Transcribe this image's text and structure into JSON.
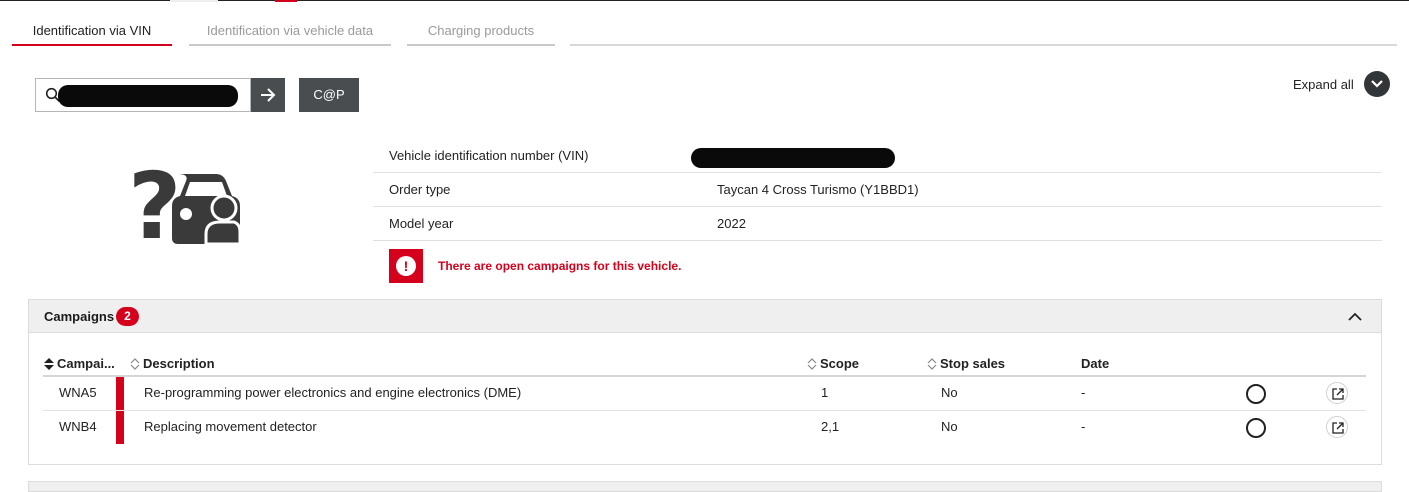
{
  "tabs": [
    {
      "label": "Identification via VIN",
      "active": true
    },
    {
      "label": "Identification via vehicle data",
      "active": false
    },
    {
      "label": "Charging products",
      "active": false
    }
  ],
  "search": {
    "value": "",
    "placeholder": ""
  },
  "buttons": {
    "go_icon": "arrow-right-icon",
    "cap_label": "C@P"
  },
  "expand": {
    "label": "Expand all",
    "icon": "chevron-down-icon"
  },
  "vehicle": {
    "icon": "unknown-car-icon",
    "rows": [
      {
        "label": "Vehicle identification number (VIN)",
        "value": ""
      },
      {
        "label": "Order type",
        "value": "Taycan 4 Cross Turismo (Y1BBD1)"
      },
      {
        "label": "Model year",
        "value": "2022"
      }
    ]
  },
  "alert": {
    "icon": "exclamation-icon",
    "message": "There are open campaigns for this vehicle.",
    "color": "#d5001c"
  },
  "campaigns": {
    "title": "Campaigns",
    "count": "2",
    "columns": [
      "Campai...",
      "Description",
      "Scope",
      "Stop sales",
      "Date"
    ],
    "rows": [
      {
        "code": "WNA5",
        "description": "Re-programming power electronics and engine electronics (DME)",
        "scope": "1",
        "stop_sales": "No",
        "date": "-"
      },
      {
        "code": "WNB4",
        "description": "Replacing movement detector",
        "scope": "2,1",
        "stop_sales": "No",
        "date": "-"
      }
    ]
  },
  "colors": {
    "accent": "#d5001c",
    "button_dark": "#4a4d50"
  }
}
